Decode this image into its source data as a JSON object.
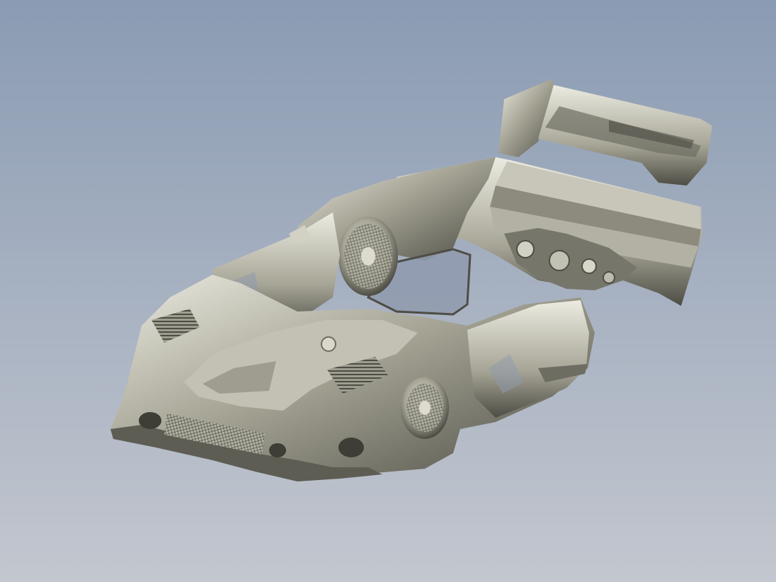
{
  "viewport": {
    "background_top": "#8a9bb3",
    "background_bottom": "#c3c7cf",
    "model_color": "#a6a596",
    "model_shadow": "#4e4d45",
    "model_highlight": "#ecebe1"
  },
  "icons": {
    "model": "scanned-race-car-mesh"
  }
}
